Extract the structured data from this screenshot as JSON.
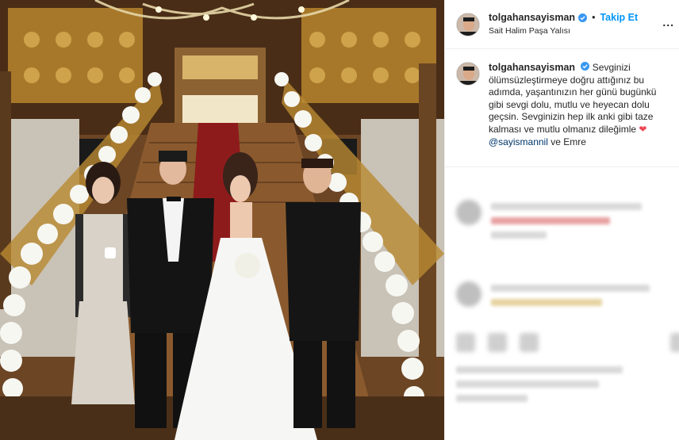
{
  "post": {
    "username": "tolgahansayisman",
    "follow_label": "Takip Et",
    "location": "Sait Halim Paşa Yalısı",
    "more_label": "..."
  },
  "caption": {
    "username": "tolgahansayisman",
    "text": "Sevginizi ölümsüzleştirmeye doğru attığınız bu adımda, yaşantınızın her günü bugünkü gibi sevgi dolu, mutlu ve heyecan dolu geçsin. Sevginizin hep ilk anki gibi taze kalması ve mutlu olmanız dileğimle",
    "mention": "@sayismannil",
    "tail": "ve Emre"
  },
  "colors": {
    "accent": "#0095f6",
    "mention": "#00376b",
    "heart": "#ed4956",
    "verified": "#3897f0"
  },
  "icons": [
    "verified-badge-icon",
    "more-options-icon",
    "heart-icon"
  ]
}
